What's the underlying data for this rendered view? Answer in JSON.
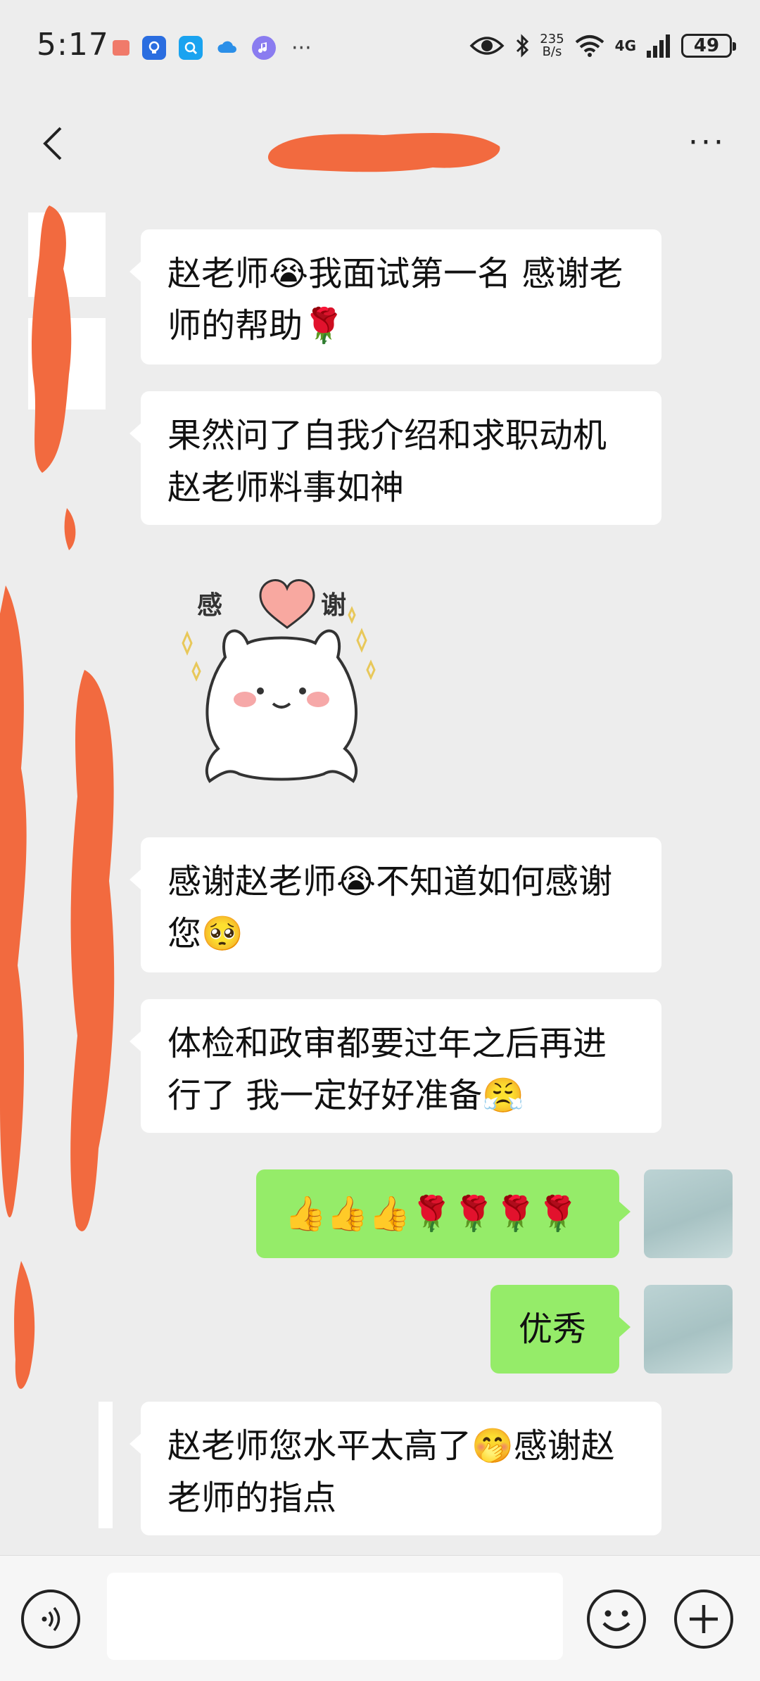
{
  "status_bar": {
    "time": "5:17",
    "net_speed_value": "235",
    "net_speed_unit": "B/s",
    "network": "4G",
    "battery": "49",
    "more_indicator": "···"
  },
  "header": {
    "more_label": "···"
  },
  "messages": [
    {
      "side": "left",
      "text": "赵老师😭我面试第一名 感谢老师的帮助🌹"
    },
    {
      "side": "left",
      "text": "果然问了自我介绍和求职动机 赵老师料事如神"
    },
    {
      "side": "left",
      "sticker_caption_left": "感",
      "sticker_caption_right": "谢"
    },
    {
      "side": "left",
      "text": "感谢赵老师😭不知道如何感谢您🥺"
    },
    {
      "side": "left",
      "text": "体检和政审都要过年之后再进行了 我一定好好准备😤"
    },
    {
      "side": "right",
      "text": "👍👍👍🌹🌹🌹🌹"
    },
    {
      "side": "right",
      "text": "优秀"
    },
    {
      "side": "left",
      "text": "赵老师您水平太高了🤭感谢赵老师的指点"
    }
  ],
  "colors": {
    "background": "#ededed",
    "bubble_self": "#95ec69",
    "bubble_other": "#ffffff",
    "redaction": "#f26a3f"
  }
}
